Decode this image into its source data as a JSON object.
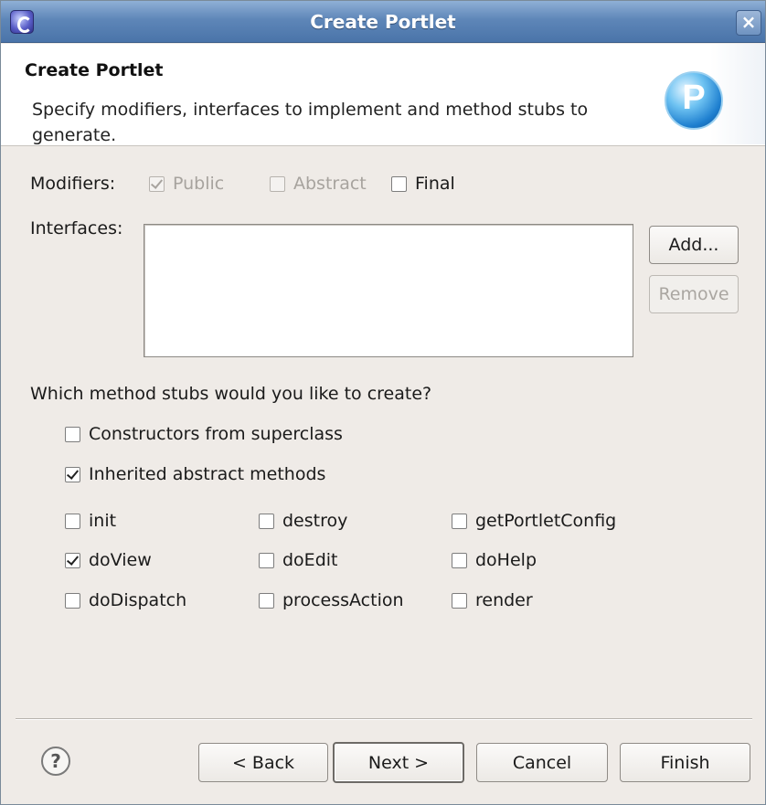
{
  "window": {
    "title": "Create Portlet",
    "close_glyph": "×"
  },
  "banner": {
    "title": "Create Portlet",
    "description": "Specify modifiers, interfaces to implement and method stubs to generate.",
    "logo_icon": "portlet-p-icon"
  },
  "modifiers": {
    "label": "Modifiers:",
    "options": [
      {
        "label": "Public",
        "checked": true,
        "enabled": false
      },
      {
        "label": "Abstract",
        "checked": false,
        "enabled": false
      },
      {
        "label": "Final",
        "checked": false,
        "enabled": true
      }
    ]
  },
  "interfaces": {
    "label": "Interfaces:",
    "items": [],
    "add_label": "Add...",
    "remove_label": "Remove"
  },
  "stubs": {
    "question": "Which method stubs would you like to create?",
    "constructors": {
      "label": "Constructors from superclass",
      "checked": false
    },
    "inherited": {
      "label": "Inherited abstract methods",
      "checked": true
    },
    "methods": [
      {
        "label": "init",
        "checked": false
      },
      {
        "label": "destroy",
        "checked": false
      },
      {
        "label": "getPortletConfig",
        "checked": false
      },
      {
        "label": "doView",
        "checked": true
      },
      {
        "label": "doEdit",
        "checked": false
      },
      {
        "label": "doHelp",
        "checked": false
      },
      {
        "label": "doDispatch",
        "checked": false
      },
      {
        "label": "processAction",
        "checked": false
      },
      {
        "label": "render",
        "checked": false
      }
    ]
  },
  "footer": {
    "help_glyph": "?",
    "back_label": "< Back",
    "next_label": "Next >",
    "cancel_label": "Cancel",
    "finish_label": "Finish"
  }
}
